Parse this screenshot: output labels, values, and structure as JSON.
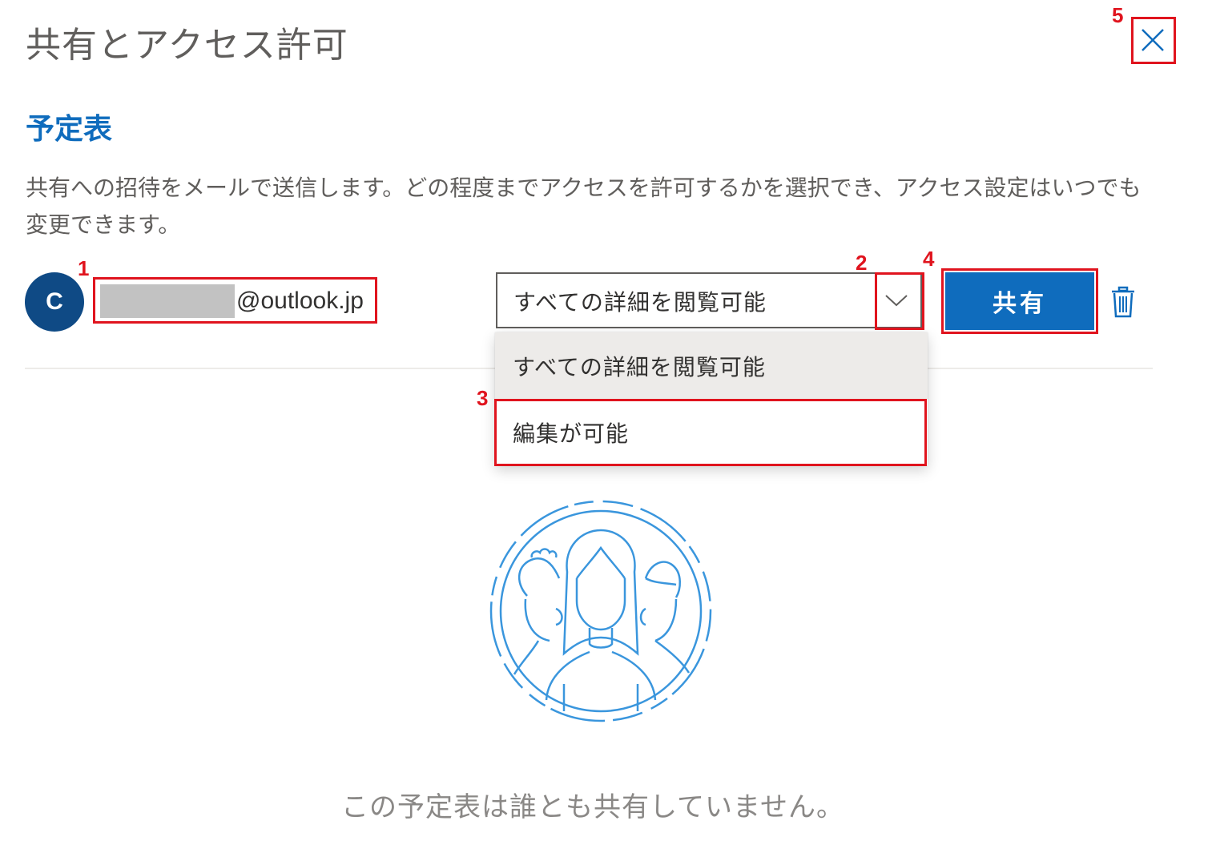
{
  "dialog": {
    "title": "共有とアクセス許可",
    "close_icon": "close-icon"
  },
  "calendar": {
    "heading": "予定表",
    "description": "共有への招待をメールで送信します。どの程度までアクセスを許可するかを選択でき、アクセス設定はいつでも変更できます。"
  },
  "invitee": {
    "avatar_initial": "C",
    "email_domain": "@outlook.jp",
    "permission_selected": "すべての詳細を閲覧可能",
    "share_label": "共有",
    "delete_icon": "trash-icon"
  },
  "permission_dropdown": {
    "options": [
      "すべての詳細を閲覧可能",
      "編集が可能"
    ]
  },
  "empty_state": {
    "text": "この予定表は誰とも共有していません。"
  },
  "annotations": [
    "1",
    "2",
    "3",
    "4",
    "5"
  ],
  "colors": {
    "accent": "#0f6cbd",
    "avatar_bg": "#0f4a85",
    "annotation_red": "#e0141e",
    "illustration_blue": "#3a96dd"
  }
}
